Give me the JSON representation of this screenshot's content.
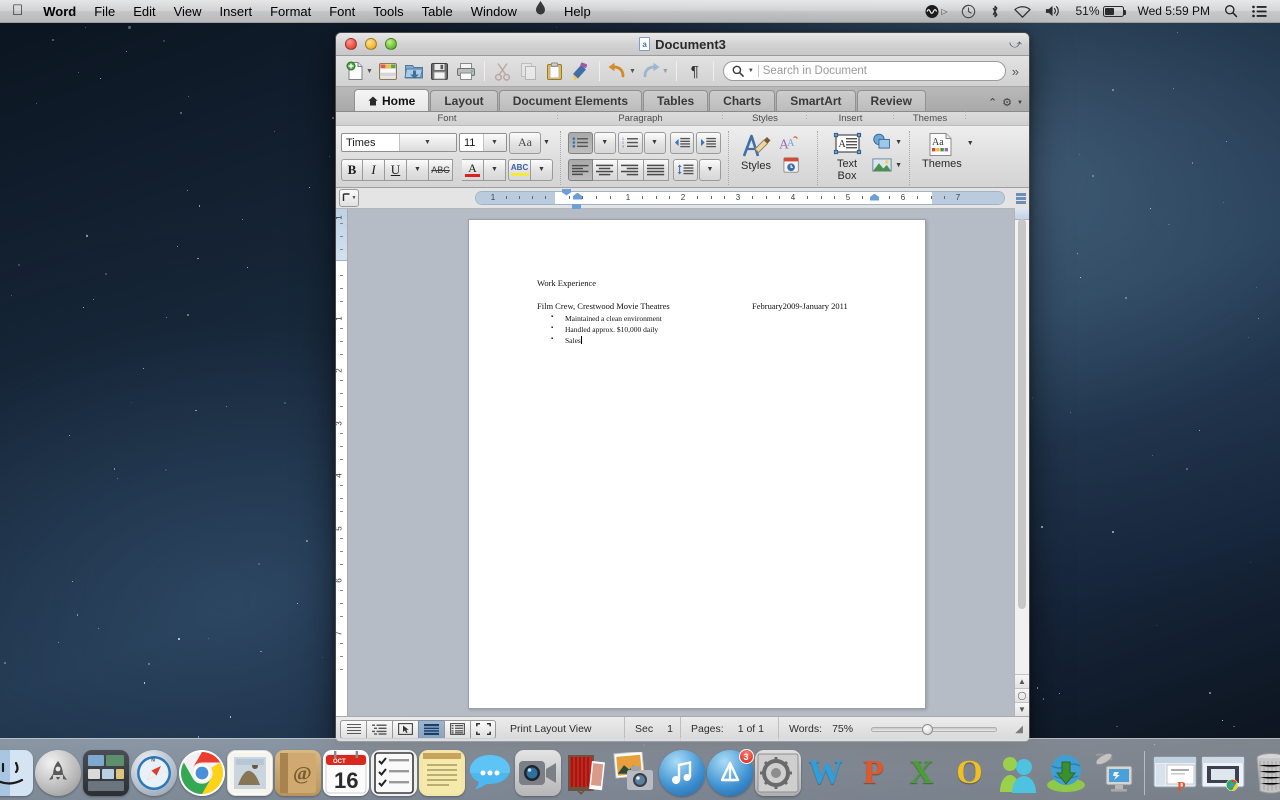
{
  "menubar": {
    "apple": "",
    "items": [
      {
        "label": "Word",
        "bold": true
      },
      {
        "label": "File",
        "bold": false
      },
      {
        "label": "Edit",
        "bold": false
      },
      {
        "label": "View",
        "bold": false
      },
      {
        "label": "Insert",
        "bold": false
      },
      {
        "label": "Format",
        "bold": false
      },
      {
        "label": "Font",
        "bold": false
      },
      {
        "label": "Tools",
        "bold": false
      },
      {
        "label": "Table",
        "bold": false
      },
      {
        "label": "Window",
        "bold": false
      },
      {
        "label": "Help",
        "bold": false
      }
    ],
    "status": {
      "battery_percent": "51%",
      "clock": "Wed 5:59 PM",
      "icons": [
        "flux-icon",
        "timemachine-icon",
        "bluetooth-icon",
        "wifi-icon",
        "volume-icon",
        "battery-icon",
        "spotlight-search-icon",
        "notification-center-icon"
      ]
    }
  },
  "window": {
    "title": "Document3",
    "controls": [
      "close-button",
      "minimize-button",
      "zoom-button",
      "fullscreen-button"
    ]
  },
  "standard_toolbar": {
    "buttons": [
      {
        "name": "new-document-button",
        "glyph": "📄"
      },
      {
        "name": "new-from-template-button",
        "glyph": "▦"
      },
      {
        "name": "open-button",
        "glyph": "📁"
      },
      {
        "name": "save-button",
        "glyph": "💾"
      },
      {
        "name": "print-button",
        "glyph": "🖨"
      },
      {
        "name": "cut-button",
        "glyph": "✂"
      },
      {
        "name": "copy-button",
        "glyph": "⧉"
      },
      {
        "name": "paste-button",
        "glyph": "📋"
      },
      {
        "name": "format-painter-button",
        "glyph": "🖌"
      },
      {
        "name": "undo-button",
        "glyph": "↶"
      },
      {
        "name": "redo-button",
        "glyph": "↷"
      },
      {
        "name": "show-formatting-marks-button",
        "glyph": "¶"
      }
    ],
    "overflow_label": "»"
  },
  "search": {
    "placeholder": "Search in Document",
    "value": ""
  },
  "ribbon": {
    "tabs": [
      {
        "label": "Home",
        "active": true,
        "icon": "home-icon"
      },
      {
        "label": "Layout",
        "active": false
      },
      {
        "label": "Document Elements",
        "active": false
      },
      {
        "label": "Tables",
        "active": false
      },
      {
        "label": "Charts",
        "active": false
      },
      {
        "label": "SmartArt",
        "active": false
      },
      {
        "label": "Review",
        "active": false
      }
    ],
    "collapse_label": "⌃",
    "gear_label": "⚙",
    "groups": [
      {
        "name": "font",
        "label": "Font"
      },
      {
        "name": "paragraph",
        "label": "Paragraph"
      },
      {
        "name": "styles",
        "label": "Styles"
      },
      {
        "name": "insert",
        "label": "Insert"
      },
      {
        "name": "themes",
        "label": "Themes"
      }
    ]
  },
  "font_group": {
    "font_name": "Times",
    "font_size": "11",
    "change_case_label": "Aa",
    "bold_label": "B",
    "italic_label": "I",
    "underline_label": "U",
    "strikethrough_label": "ABC",
    "font_color_label": "A",
    "highlight_label": "ABC"
  },
  "paragraph_group": {
    "buttons": [
      "bulleted-list-button",
      "numbered-list-button",
      "decrease-indent-button",
      "increase-indent-button",
      "align-left-button",
      "align-center-button",
      "align-right-button",
      "justify-button",
      "line-spacing-button"
    ]
  },
  "styles_group": {
    "label": "Styles"
  },
  "insert_group": {
    "label": "Text Box"
  },
  "themes_group": {
    "label": "Themes"
  },
  "ruler": {
    "horizontal_numbers": [
      "1",
      "1",
      "2",
      "3",
      "4",
      "5",
      "6",
      "7"
    ],
    "vertical_numbers": [
      "1",
      "1",
      "2",
      "3",
      "4",
      "5",
      "6",
      "7"
    ]
  },
  "document": {
    "heading": "Work Experience",
    "job_title": "Film Crew, Crestwood Movie Theatres",
    "job_dates": "February2009-January 2011",
    "bullets": [
      "Maintained a clean environment",
      "Handled approx. $10,000 daily",
      "Sales"
    ]
  },
  "statusbar": {
    "view_buttons": [
      {
        "name": "draft-view-button",
        "selected": false
      },
      {
        "name": "outline-view-button",
        "selected": false
      },
      {
        "name": "publishing-layout-view-button",
        "selected": false
      },
      {
        "name": "print-layout-view-button",
        "selected": true
      },
      {
        "name": "notebook-layout-view-button",
        "selected": false
      },
      {
        "name": "focus-view-button",
        "selected": false
      }
    ],
    "view_label": "Print Layout View",
    "sec_label": "Sec",
    "sec_value": "1",
    "pages_label": "Pages:",
    "pages_value": "1 of 1",
    "words_label": "Words:",
    "zoom_value": "75%"
  },
  "dock": {
    "items": [
      {
        "name": "finder",
        "icon": "finder-icon",
        "running": true
      },
      {
        "name": "launchpad",
        "icon": "launchpad-icon",
        "running": false
      },
      {
        "name": "mission-control",
        "icon": "mission-control-icon",
        "running": false
      },
      {
        "name": "safari",
        "icon": "safari-icon",
        "running": false
      },
      {
        "name": "google-chrome",
        "icon": "chrome-icon",
        "running": true
      },
      {
        "name": "mail",
        "icon": "mail-stamp-icon",
        "running": false
      },
      {
        "name": "contacts",
        "icon": "contacts-book-icon",
        "running": false
      },
      {
        "name": "calendar",
        "icon": "calendar-icon",
        "running": false,
        "day": "16",
        "month": "OCT"
      },
      {
        "name": "reminders",
        "icon": "reminders-icon",
        "running": false
      },
      {
        "name": "notes",
        "icon": "notes-icon",
        "running": false
      },
      {
        "name": "messages",
        "icon": "messages-icon",
        "running": false
      },
      {
        "name": "facetime",
        "icon": "facetime-icon",
        "running": false
      },
      {
        "name": "photo-booth",
        "icon": "photo-booth-icon",
        "running": false
      },
      {
        "name": "iphoto",
        "icon": "iphoto-icon",
        "running": false
      },
      {
        "name": "itunes",
        "icon": "itunes-icon",
        "running": false
      },
      {
        "name": "app-store",
        "icon": "app-store-icon",
        "running": false,
        "badge": "3"
      },
      {
        "name": "system-preferences",
        "icon": "system-preferences-icon",
        "running": false
      },
      {
        "name": "microsoft-word",
        "icon": "word-icon",
        "letter": "W",
        "running": true
      },
      {
        "name": "microsoft-powerpoint",
        "icon": "powerpoint-icon",
        "letter": "P",
        "running": false
      },
      {
        "name": "microsoft-excel",
        "icon": "excel-icon",
        "letter": "X",
        "running": false
      },
      {
        "name": "microsoft-outlook",
        "icon": "outlook-icon",
        "letter": "O",
        "running": false
      },
      {
        "name": "messenger",
        "icon": "messenger-people-icon",
        "running": false
      },
      {
        "name": "downloads-globe",
        "icon": "download-globe-icon",
        "running": false
      },
      {
        "name": "remote-desktop",
        "icon": "remote-desktop-icon",
        "running": false
      }
    ],
    "minimized": [
      {
        "name": "minimized-powerpoint-window",
        "icon": "window-thumb-powerpoint"
      },
      {
        "name": "minimized-chrome-window",
        "icon": "window-thumb-chrome"
      }
    ],
    "trash": {
      "name": "trash",
      "icon": "trash-icon"
    }
  },
  "colors": {
    "accent": "#6e9fd4",
    "selection": "#8aa4bd",
    "desktop": "#16253a",
    "red": "#d8251a"
  }
}
